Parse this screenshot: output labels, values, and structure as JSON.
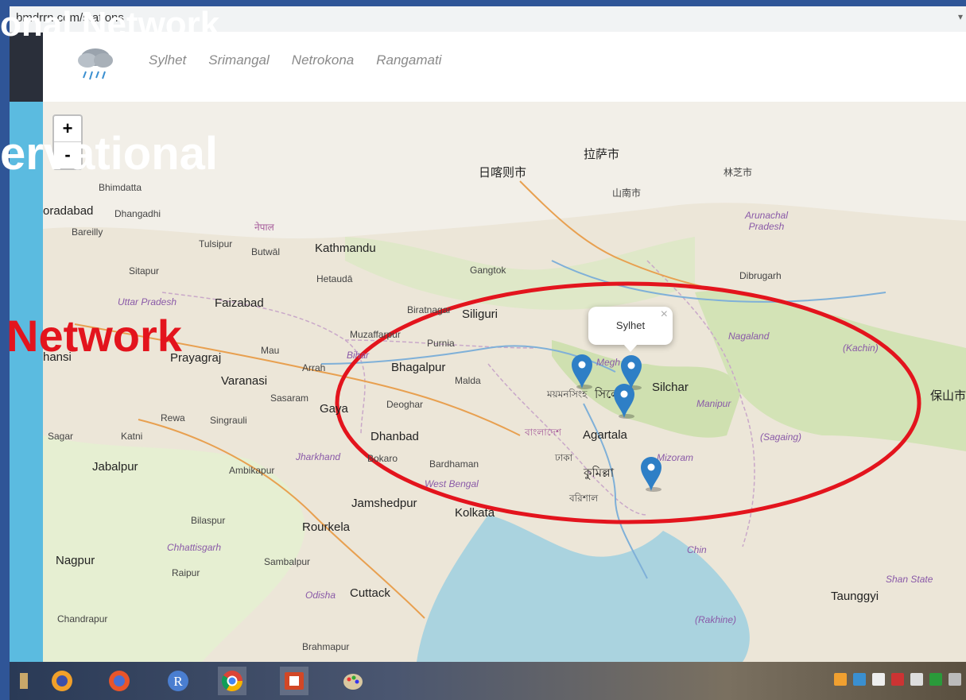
{
  "browser": {
    "url": "bmdrrn.com/stations"
  },
  "nav": {
    "items": [
      "Sylhet",
      "Srimangal",
      "Netrokona",
      "Rangamati"
    ]
  },
  "zoom": {
    "in_label": "+",
    "out_label": "-"
  },
  "popup": {
    "text": "Sylhet",
    "close": "×"
  },
  "overlay_text": {
    "line1": "onal Network",
    "line2": "ervational",
    "line3": "Network"
  },
  "map_labels": {
    "kathmandu": "Kathmandu",
    "gangtok": "Gangtok",
    "siliguri": "Siliguri",
    "dibrugarh": "Dibrugarh",
    "faizabad": "Faizabad",
    "prayagraj": "Prayagraj",
    "varanasi": "Varanasi",
    "bhagalpur": "Bhagalpur",
    "gaya": "Gaya",
    "dhanbad": "Dhanbad",
    "agartala": "Agartala",
    "silchar": "Silchar",
    "jabalpur": "Jabalpur",
    "nagpur": "Nagpur",
    "rourkela": "Rourkela",
    "jamshedpur": "Jamshedpur",
    "kolkata": "Kolkata",
    "cuttack": "Cuttack",
    "taunggyi": "Taunggyi",
    "chandrapur": "Chandrapur",
    "bilaspur": "Bilaspur",
    "raipur": "Raipur",
    "sambalpur": "Sambalpur",
    "brahmapur": "Brahmapur",
    "purnia": "Purnia",
    "malda": "Malda",
    "deoghar": "Deoghar",
    "bokaro": "Bokaro",
    "bardhaman": "Bardhaman",
    "muzaffarpur": "Muzaffarpur",
    "biratnagar": "Biratnagar",
    "hetauda": "Hetaudā",
    "butwal": "Butwāl",
    "tulsipur": "Tulsipur",
    "bareilly": "Bareilly",
    "sitapur": "Sitapur",
    "mau": "Mau",
    "rewa": "Rewa",
    "singrauli": "Singrauli",
    "katni": "Katni",
    "sagar": "Sagar",
    "ambikapur": "Ambikapur",
    "bhimdatta": "Bhimdatta",
    "dhangadhi": "Dhangadhi",
    "moradabad": "oradabad",
    "jhansi": "hansi",
    "sasaram": "Sasaram",
    "arrah": "Arrah",
    "uttar_pradesh": "Uttar Pradesh",
    "bihar": "Bihar",
    "jharkhand": "Jharkhand",
    "west_bengal": "West Bengal",
    "chhattisgarh": "Chhattisgarh",
    "odisha": "Odisha",
    "arunachal": "Arunachal Pradesh",
    "nagaland": "Nagaland",
    "manipur": "Manipur",
    "mizoram": "Mizoram",
    "chin": "Chin",
    "sagaing": "(Sagaing)",
    "kachin": "(Kachin)",
    "shan": "Shan State",
    "rakhine": "(Rakhine)",
    "lhasa": "拉萨市",
    "xigaze": "日喀则市",
    "nyingchi": "林芝市",
    "shannan": "山南市",
    "baoshan": "保山市",
    "dhaka": "ঢাকা",
    "bangladesh": "বাংলাদেশ",
    "comilla": "কুমিল্লা",
    "barishal": "বরিশাল",
    "nepal": "नेपाल",
    "mymensingh": "ময়মনসিংহ",
    "sylhet_bn": "সিলে",
    "meghalaya": "Megh"
  }
}
